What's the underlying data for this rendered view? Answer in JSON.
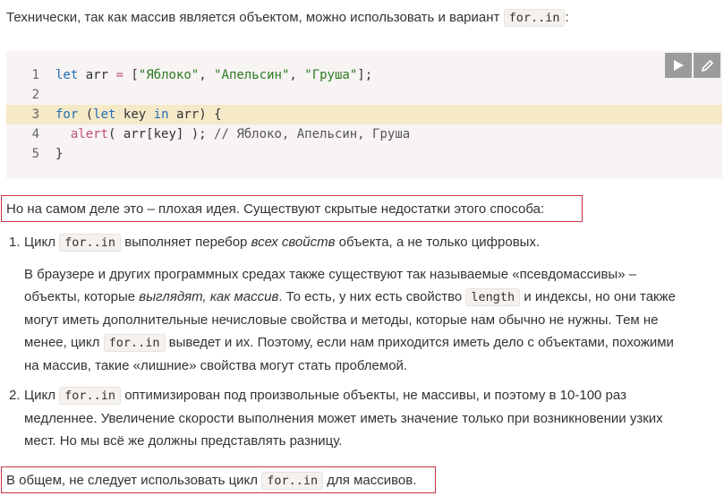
{
  "intro": {
    "text": "Технически, так как массив является объектом, можно использовать и вариант",
    "code": "for..in",
    "tail": ":"
  },
  "code": {
    "line_numbers": [
      "1",
      "2",
      "3",
      "4",
      "5"
    ],
    "l1": {
      "kw": "let",
      "var": "arr",
      "eq": "=",
      "open": "[",
      "s1": "\"Яблоко\"",
      "c1": ",",
      "s2": "\"Апельсин\"",
      "c2": ",",
      "s3": "\"Груша\"",
      "close": "];"
    },
    "l3": {
      "kw1": "for",
      "p1": "(",
      "kw2": "let",
      "mid": "key",
      "kw3": "in",
      "tail": "arr) {"
    },
    "l4": {
      "fn": "alert",
      "rest": "( arr[key] ); ",
      "comment": "// Яблоко, Апельсин, Груша"
    },
    "l5": {
      "text": "}"
    },
    "toolbar": {
      "run_icon": "play-icon",
      "edit_icon": "pencil-icon"
    }
  },
  "warning": "Но на самом деле это – плохая идея. Существуют скрытые недостатки этого способа:",
  "item1": {
    "num": "1.",
    "a": "Цикл",
    "code": "for..in",
    "b": "выполняет перебор",
    "em": "всех свойств",
    "c": "объекта, а не только цифровых."
  },
  "sub": {
    "a": "В браузере и других программных средах также существуют так называемые «псевдомассивы» –",
    "b": "объекты, которые",
    "em": "выглядят, как массив",
    "c": ". То есть, у них есть свойство",
    "code1": "length",
    "d": "и индексы, но они также",
    "e": "могут иметь дополнительные нечисловые свойства и методы, которые нам обычно не нужны. Тем не",
    "f": "менее, цикл",
    "code2": "for..in",
    "g": "выведет и их. Поэтому, если нам приходится иметь дело с объектами, похожими",
    "h": "на массив, такие «лишние» свойства могут стать проблемой."
  },
  "item2": {
    "num": "2.",
    "a": "Цикл",
    "code": "for..in",
    "b": "оптимизирован под произвольные объекты, не массивы, и поэтому в 10-100 раз",
    "c": "медленнее. Увеличение скорости выполнения может иметь значение только при возникновении узких",
    "d": "мест. Но мы всё же должны представлять разницу."
  },
  "conclusion": {
    "a": "В общем, не следует использовать цикл",
    "code": "for..in",
    "b": "для массивов."
  }
}
